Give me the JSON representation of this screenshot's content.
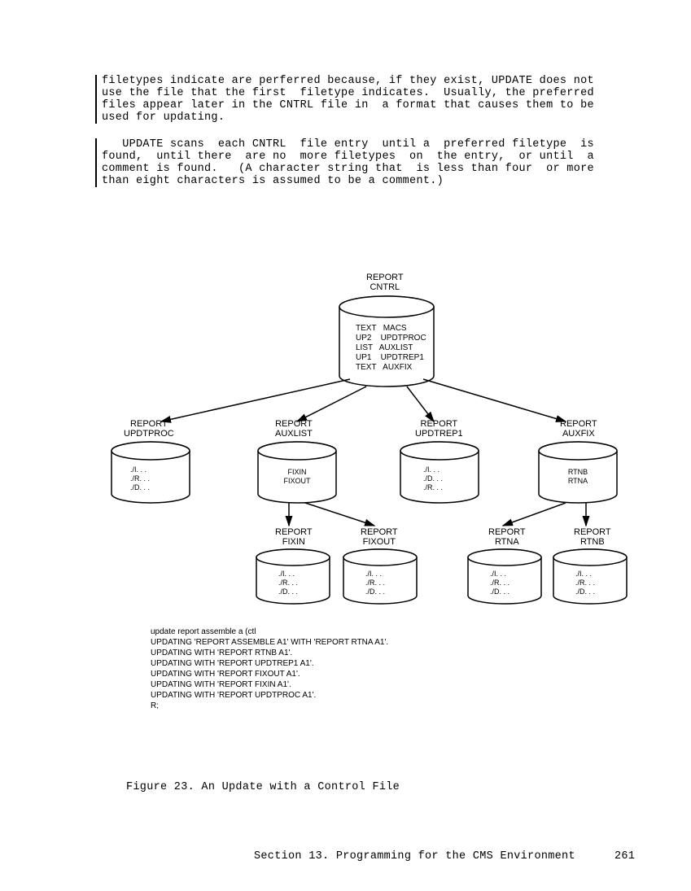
{
  "paragraph1": "filetypes indicate are perferred because, if they exist, UPDATE does not\nuse the file that the first  filetype indicates.  Usually, the preferred\nfiles appear later in the CNTRL file in  a format that causes them to be\nused for updating.",
  "paragraph2": "   UPDATE scans  each CNTRL  file entry  until a  preferred filetype  is\nfound,  until there  are no  more filetypes  on  the entry,  or until  a\ncomment is found.   (A character string that  is less than four  or more\nthan eight characters is assumed to be a comment.)",
  "diagram": {
    "root_label": "REPORT\nCNTRL",
    "cntrl_rows": "TEXT   MACS\nUP2    UPDTPROC\nLIST   AUXLIST\nUP1    UPDTREP1\nTEXT   AUXFIX",
    "lvl2": {
      "updtproc": {
        "label": "REPORT\nUPDTPROC",
        "content": "./I. . .\n./R. . .\n./D. . ."
      },
      "auxlist": {
        "label": "REPORT\nAUXLIST",
        "content": "FIXIN\nFIXOUT"
      },
      "updtrep1": {
        "label": "REPORT\nUPDTREP1",
        "content": "./I. . .\n./D. . .\n./R. . ."
      },
      "auxfix": {
        "label": "REPORT\nAUXFIX",
        "content": "RTNB\nRTNA"
      }
    },
    "lvl3": {
      "fixin": {
        "label": "REPORT\nFIXIN",
        "content": "./I. . .\n./R. . .\n./D. . ."
      },
      "fixout": {
        "label": "REPORT\nFIXOUT",
        "content": "./I. . .\n./R. . .\n./D. . ."
      },
      "rtna": {
        "label": "REPORT\nRTNA",
        "content": "./I. . .\n./R. . .\n./D. . ."
      },
      "rtnb": {
        "label": "REPORT\nRTNB",
        "content": "./I. . .\n./R. . .\n./D. . ."
      }
    }
  },
  "console_output": "update report assemble a (ctl\nUPDATING 'REPORT ASSEMBLE A1' WITH 'REPORT RTNA A1'.\nUPDATING WITH 'REPORT RTNB A1'.\nUPDATING WITH 'REPORT UPDTREP1 A1'.\nUPDATING WITH 'REPORT FIXOUT A1'.\nUPDATING WITH 'REPORT FIXIN A1'.\nUPDATING WITH 'REPORT UPDTPROC A1'.\nR;",
  "figure_caption": "Figure 23. An Update with a Control File",
  "footer_section": "Section 13. Programming for the CMS Environment",
  "page_number": "261"
}
